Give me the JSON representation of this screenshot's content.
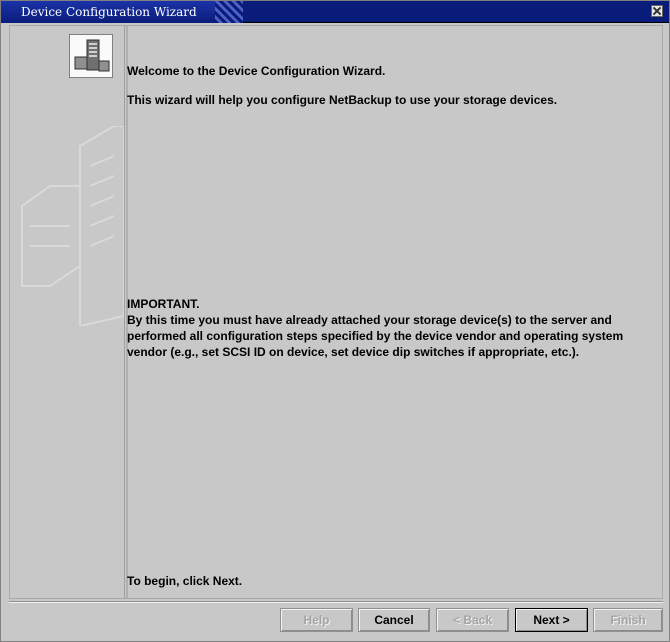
{
  "window": {
    "title": "Device Configuration Wizard"
  },
  "content": {
    "welcome": "Welcome to the Device Configuration Wizard.",
    "intro": "This wizard will help you configure NetBackup to use your storage devices.",
    "important_heading": "IMPORTANT.",
    "important_body": "By this time you must have already attached your storage device(s) to the server and performed all configuration steps specified by the device vendor and operating system vendor (e.g., set SCSI ID on device, set device dip switches if appropriate, etc.).",
    "begin": "To begin, click Next."
  },
  "buttons": {
    "help": "Help",
    "cancel": "Cancel",
    "back": "< Back",
    "next": "Next >",
    "finish": "Finish"
  },
  "colors": {
    "titlebar": "#0a1c7a",
    "background": "#c8c8c8"
  },
  "icons": {
    "wizard": "server-tower-icon",
    "close": "close-icon"
  }
}
